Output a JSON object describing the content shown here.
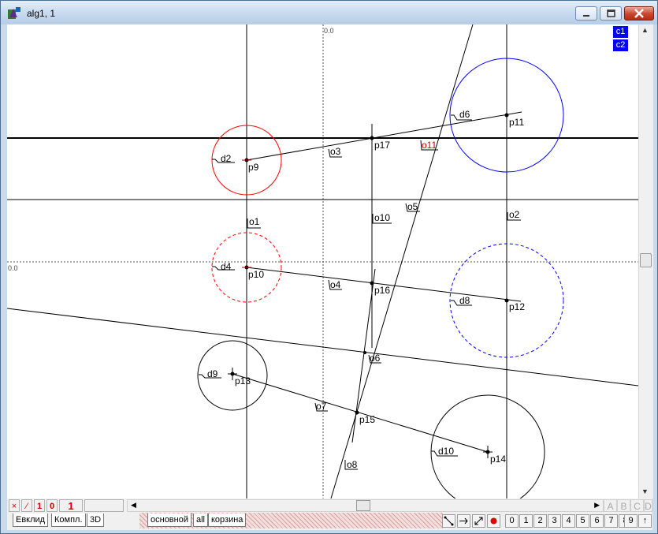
{
  "window": {
    "title": "alg1, 1"
  },
  "canvas": {
    "axis_labels": [
      "0.0",
      "0.0"
    ],
    "lines": {
      "o1": "o1",
      "o2": "o2",
      "o3": "o3",
      "o4": "o4",
      "o5": "o5",
      "o6": "o6",
      "o7": "o7",
      "o8": "o8",
      "o10": "o10",
      "o11": "o11"
    },
    "points": {
      "p9": "p9",
      "p10": "p10",
      "p11": "p11",
      "p12": "p12",
      "p13": "p13",
      "p14": "p14",
      "p15": "p15",
      "p16": "p16",
      "p17": "p17"
    },
    "circles": {
      "d2": "d2",
      "d4": "d4",
      "d6": "d6",
      "d8": "d8",
      "d9": "d9",
      "d10": "d10"
    },
    "badges": [
      "c1",
      "c2"
    ],
    "colors": {
      "red": "#ff0000",
      "blue": "#0000ff",
      "black": "#000000",
      "red_label": "#cc0000"
    }
  },
  "status": {
    "x": "×",
    "slash": "⁄",
    "one": "1",
    "zero": "0",
    "num": "1"
  },
  "letters": [
    "A",
    "B",
    "C",
    "D"
  ],
  "tabs": {
    "left": [
      "Евклид",
      "Компл.",
      "3D"
    ],
    "right": [
      "основной",
      "all",
      "корзина"
    ]
  },
  "toolbar": {
    "digits": [
      "0",
      "1",
      "2",
      "3",
      "4",
      "5",
      "6",
      "7",
      "8",
      "9"
    ],
    "up": "↑"
  }
}
